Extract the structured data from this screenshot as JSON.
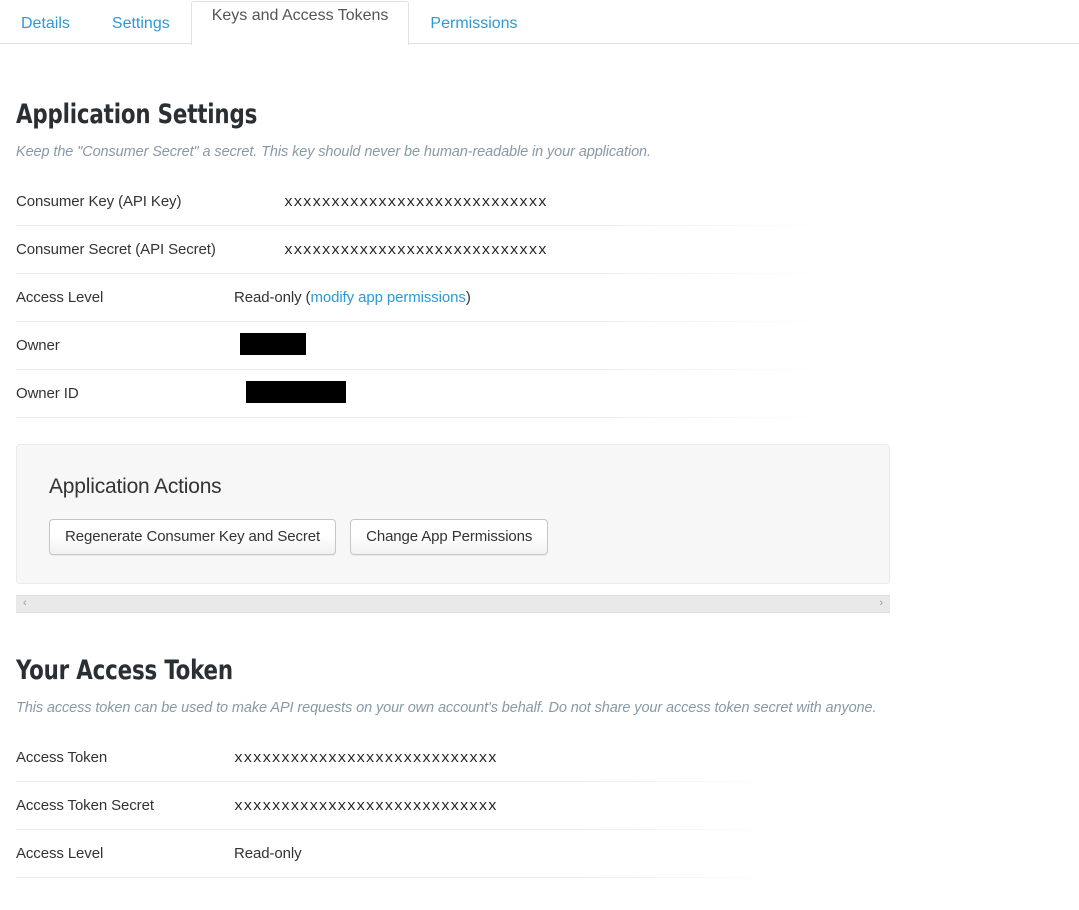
{
  "tabs": [
    {
      "label": "Details",
      "active": false
    },
    {
      "label": "Settings",
      "active": false
    },
    {
      "label": "Keys and Access Tokens",
      "active": true
    },
    {
      "label": "Permissions",
      "active": false
    }
  ],
  "app_settings": {
    "heading": "Application Settings",
    "subtitle": "Keep the \"Consumer Secret\" a secret. This key should never be human-readable in your application.",
    "rows": [
      {
        "key": "Consumer Key (API Key)",
        "value": "xxxxxxxxxxxxxxxxxxxxxxxxxxxx",
        "type": "mono"
      },
      {
        "key": "Consumer Secret (API Secret)",
        "value": "xxxxxxxxxxxxxxxxxxxxxxxxxxxx",
        "type": "mono"
      },
      {
        "key": "Access Level",
        "value": "Read-only (",
        "link_text": "modify app permissions",
        "value_suffix": ")",
        "type": "link"
      },
      {
        "key": "Owner",
        "value": "",
        "type": "redacted",
        "redact_width": 66
      },
      {
        "key": "Owner ID",
        "value": "",
        "type": "redacted",
        "redact_width": 100
      }
    ]
  },
  "actions": {
    "title": "Application Actions",
    "buttons": [
      {
        "label": "Regenerate Consumer Key and Secret"
      },
      {
        "label": "Change App Permissions"
      }
    ]
  },
  "scrollbar": {
    "left_arrow": "‹",
    "right_arrow": "›"
  },
  "access_token": {
    "heading": "Your Access Token",
    "subtitle": "This access token can be used to make API requests on your own account's behalf. Do not share your access token secret with anyone.",
    "rows": [
      {
        "key": "Access Token",
        "value": "xxxxxxxxxxxxxxxxxxxxxxxxxxxx",
        "type": "mono"
      },
      {
        "key": "Access Token Secret",
        "value": "xxxxxxxxxxxxxxxxxxxxxxxxxxxx",
        "type": "mono"
      },
      {
        "key": "Access Level",
        "value": "Read-only",
        "type": "text"
      }
    ]
  },
  "colors": {
    "link": "#2b9ad4",
    "heading": "#292f33",
    "subtitle": "#8899a6",
    "panel_bg": "#f7f7f7",
    "divider": "#ededed"
  }
}
